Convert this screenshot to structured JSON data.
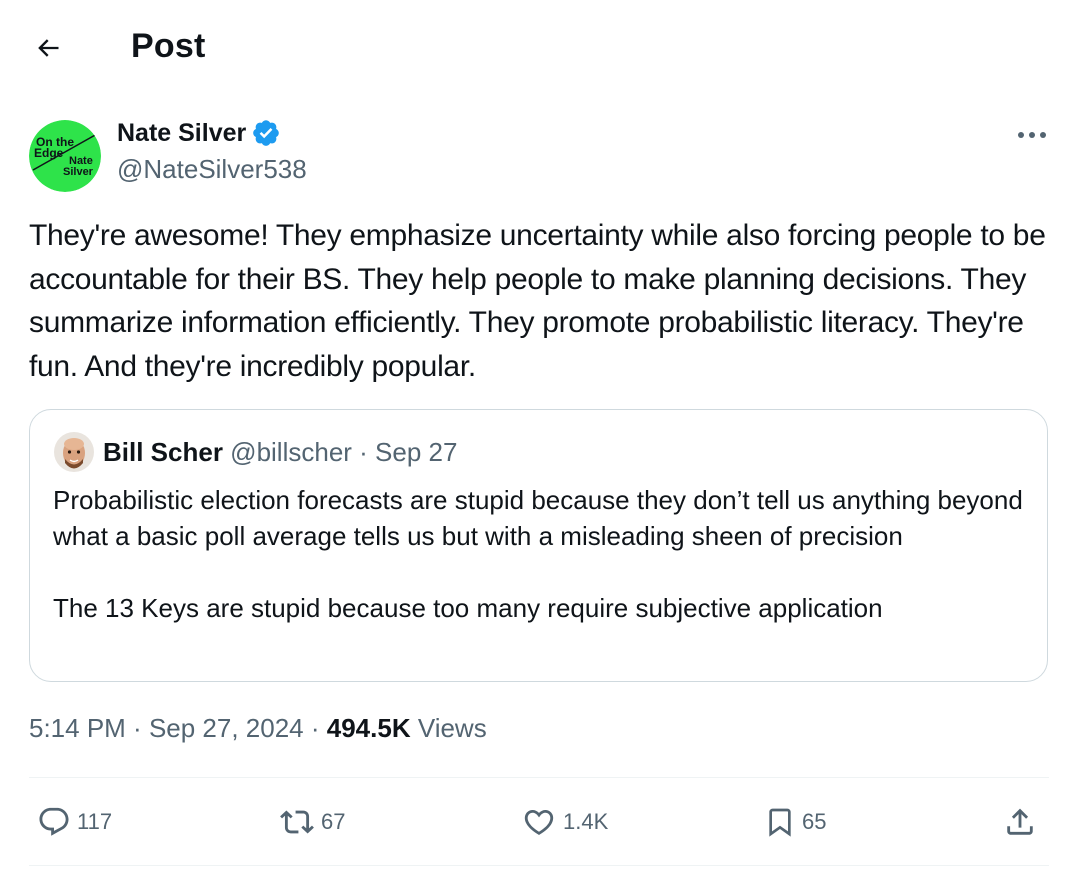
{
  "header": {
    "title": "Post",
    "back_icon": "back-arrow-icon"
  },
  "tweet": {
    "author": {
      "name": "Nate Silver",
      "handle": "@NateSilver538",
      "verified": true,
      "avatar_icon": "avatar-on-the-edge-logo",
      "avatar_text": [
        "On the",
        "Edge",
        "Nate",
        "Silver"
      ],
      "avatar_color": "#2ee34a"
    },
    "text": "They're awesome! They emphasize uncertainty while also forcing people to be accountable for their BS. They help people to make planning decisions. They summarize information efficiently. They promote probabilistic literacy. They're fun. And they're incredibly popular.",
    "quote": {
      "name": "Bill Scher",
      "handle": "@billscher",
      "separator": " · ",
      "date": "Sep 27",
      "text": "Probabilistic election forecasts are stupid because they don’t tell us anything beyond what a basic poll average tells us but with a misleading sheen of precision\n\nThe 13 Keys are stupid because too many require subjective application"
    },
    "time": "5:14 PM",
    "sep": " · ",
    "date": "Sep 27, 2024",
    "views_count": "494.5K",
    "views_label": "Views",
    "actions": {
      "replies": "117",
      "reposts": "67",
      "likes": "1.4K",
      "bookmarks": "65"
    }
  },
  "colors": {
    "text": "#0f1419",
    "secondary": "#536471",
    "verified_blue": "#1d9bf0",
    "border": "#cfd9de"
  }
}
